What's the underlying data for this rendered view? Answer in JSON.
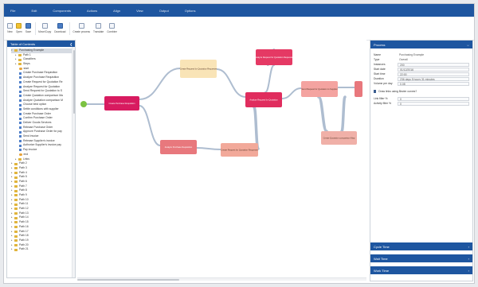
{
  "menu": [
    "File",
    "Edit",
    "Components",
    "Actions",
    "Align",
    "View",
    "Output",
    "Options"
  ],
  "toolbar": [
    {
      "label": "New",
      "icon": "new-icon"
    },
    {
      "label": "Open",
      "icon": "open-icon"
    },
    {
      "label": "Save",
      "icon": "save-icon"
    },
    {
      "label": "Move/Copy",
      "icon": "move-copy-icon"
    },
    {
      "label": "Download",
      "icon": "download-icon"
    },
    {
      "label": "Create process",
      "icon": "create-process-icon"
    },
    {
      "label": "Translate",
      "icon": "translate-icon"
    },
    {
      "label": "Combine",
      "icon": "combine-icon"
    }
  ],
  "toc": {
    "title": "Table of Contents",
    "root": "Purchasing Example",
    "selected": "Purchasing Example",
    "items": [
      {
        "label": "Purchasing Example",
        "level": 1,
        "type": "folder",
        "selected": true
      },
      {
        "label": "Path 1",
        "level": 2,
        "type": "folder"
      },
      {
        "label": "Classifiers",
        "level": 2,
        "type": "folder"
      },
      {
        "label": "Steps",
        "level": 2,
        "type": "folder"
      },
      {
        "label": "start",
        "level": 3,
        "type": "circle"
      },
      {
        "label": "Create Purchase Requisition",
        "level": 3,
        "type": "step"
      },
      {
        "label": "Analyze Purchase Requisition",
        "level": 3,
        "type": "step"
      },
      {
        "label": "Create Request for Quotation Re",
        "level": 3,
        "type": "step"
      },
      {
        "label": "Analyze Request for Quotation",
        "level": 3,
        "type": "step"
      },
      {
        "label": "Send Request for Quotation to S",
        "level": 3,
        "type": "step"
      },
      {
        "label": "Create Quotation comparison Ma",
        "level": 3,
        "type": "step"
      },
      {
        "label": "Analyze Quotation comparison M",
        "level": 3,
        "type": "step"
      },
      {
        "label": "Choose best option",
        "level": 3,
        "type": "step"
      },
      {
        "label": "Settle conditions with supplier",
        "level": 3,
        "type": "step"
      },
      {
        "label": "Create Purchase Order",
        "level": 3,
        "type": "step"
      },
      {
        "label": "Confirm Purchase Order",
        "level": 3,
        "type": "step"
      },
      {
        "label": "Deliver Goods Services",
        "level": 3,
        "type": "step"
      },
      {
        "label": "Release Purchase Order",
        "level": 3,
        "type": "step"
      },
      {
        "label": "Approve Purchase Order for pay",
        "level": 3,
        "type": "step"
      },
      {
        "label": "Send invoice",
        "level": 3,
        "type": "step"
      },
      {
        "label": "Release Supplier's invoice",
        "level": 3,
        "type": "step"
      },
      {
        "label": "Authorize Supplier's invoice pay",
        "level": 3,
        "type": "step"
      },
      {
        "label": "Pay invoice",
        "level": 3,
        "type": "step"
      },
      {
        "label": "end",
        "level": 3,
        "type": "circle"
      },
      {
        "label": "Links",
        "level": 2,
        "type": "folder"
      },
      {
        "label": "Path 2",
        "level": 1,
        "type": "folder"
      },
      {
        "label": "Path 3",
        "level": 1,
        "type": "folder"
      },
      {
        "label": "Path 4",
        "level": 1,
        "type": "folder"
      },
      {
        "label": "Path 5",
        "level": 1,
        "type": "folder"
      },
      {
        "label": "Path 6",
        "level": 1,
        "type": "folder"
      },
      {
        "label": "Path 7",
        "level": 1,
        "type": "folder"
      },
      {
        "label": "Path 8",
        "level": 1,
        "type": "folder"
      },
      {
        "label": "Path 9",
        "level": 1,
        "type": "folder"
      },
      {
        "label": "Path 10",
        "level": 1,
        "type": "folder"
      },
      {
        "label": "Path 11",
        "level": 1,
        "type": "folder"
      },
      {
        "label": "Path 12",
        "level": 1,
        "type": "folder"
      },
      {
        "label": "Path 13",
        "level": 1,
        "type": "folder"
      },
      {
        "label": "Path 14",
        "level": 1,
        "type": "folder"
      },
      {
        "label": "Path 15",
        "level": 1,
        "type": "folder"
      },
      {
        "label": "Path 16",
        "level": 1,
        "type": "folder"
      },
      {
        "label": "Path 17",
        "level": 1,
        "type": "folder"
      },
      {
        "label": "Path 18",
        "level": 1,
        "type": "folder"
      },
      {
        "label": "Path 19",
        "level": 1,
        "type": "folder"
      },
      {
        "label": "Path 20",
        "level": 1,
        "type": "folder"
      },
      {
        "label": "Path 21",
        "level": 1,
        "type": "folder"
      }
    ]
  },
  "process": {
    "nodes": [
      {
        "label": "Create Purchase Requisition",
        "color": "#d81b60"
      },
      {
        "label": "Create Request for Quotation Requester",
        "color": "#f9e4b7"
      },
      {
        "label": "Analyze Request for Quotation Requester",
        "color": "#e53964"
      },
      {
        "label": "Analyze Purchase Requisition",
        "color": "#e8787d"
      },
      {
        "label": "Create Request for Quotation Requester",
        "color": "#f2a99a"
      },
      {
        "label": "Analyze Request for Quotation",
        "color": "#e02d5e"
      },
      {
        "label": "Send Request for Quotation to Supplier",
        "color": "#f4a3a0"
      },
      {
        "label": "Create Quotation comparison Map",
        "color": "#f0b0a8"
      },
      {
        "label": "Analyze Quotation comparison Map",
        "color": "#e8787d"
      }
    ],
    "start_color": "#7cc242",
    "edge_color": "#aebdd0"
  },
  "properties": {
    "title": "Process",
    "rows": [
      {
        "key": "Name",
        "value": "Purchasing Example"
      },
      {
        "key": "Type",
        "value": "Overall"
      },
      {
        "key": "Instances",
        "value": "200"
      },
      {
        "key": "Start date",
        "value": "01/12/2016"
      },
      {
        "key": "Start time",
        "value": "22:00"
      },
      {
        "key": "Duration",
        "value": "236 days 5 hours 31 minutes"
      },
      {
        "key": "Volume per day",
        "value": "0.08"
      }
    ],
    "bezier_label": "Draw links using Bezier curves?",
    "link_filter_label": "Link filter %",
    "link_filter_value": "0",
    "activity_filter_label": "Activity filter %",
    "activity_filter_value": "0"
  },
  "sections": [
    "Cycle Time",
    "Wait Time",
    "Work Time"
  ]
}
